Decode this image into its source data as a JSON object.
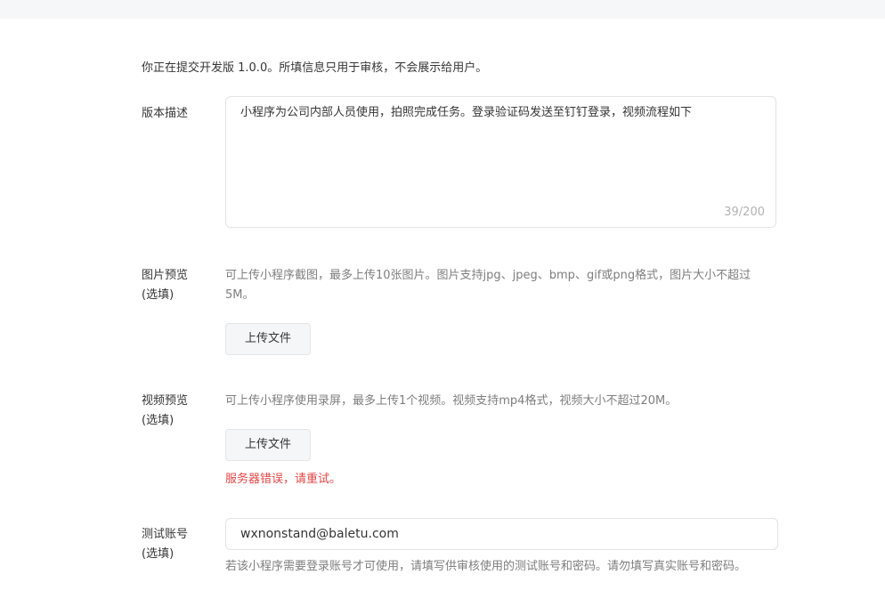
{
  "notice": "你正在提交开发版 1.0.0。所填信息只用于审核，不会展示给用户。",
  "version_desc": {
    "label": "版本描述",
    "value": "小程序为公司内部人员使用，拍照完成任务。登录验证码发送至钉钉登录，视频流程如下",
    "counter": "39/200"
  },
  "image_preview": {
    "label_line1": "图片预览",
    "label_line2": "(选填)",
    "description": "可上传小程序截图，最多上传10张图片。图片支持jpg、jpeg、bmp、gif或png格式，图片大小不超过5M。",
    "upload_label": "上传文件"
  },
  "video_preview": {
    "label_line1": "视频预览",
    "label_line2": "(选填)",
    "description": "可上传小程序使用录屏，最多上传1个视频。视频支持mp4格式，视频大小不超过20M。",
    "upload_label": "上传文件",
    "error": "服务器错误，请重试。"
  },
  "test_account": {
    "label_line1": "测试账号",
    "label_line2": "(选填)",
    "value": "wxnonstand@baletu.com",
    "hint": "若该小程序需要登录账号才可使用，请填写供审核使用的测试账号和密码。请勿填写真实账号和密码。"
  },
  "colors": {
    "error": "#e54545",
    "border": "#e2e3e6",
    "muted_text": "#7e7e7e"
  }
}
